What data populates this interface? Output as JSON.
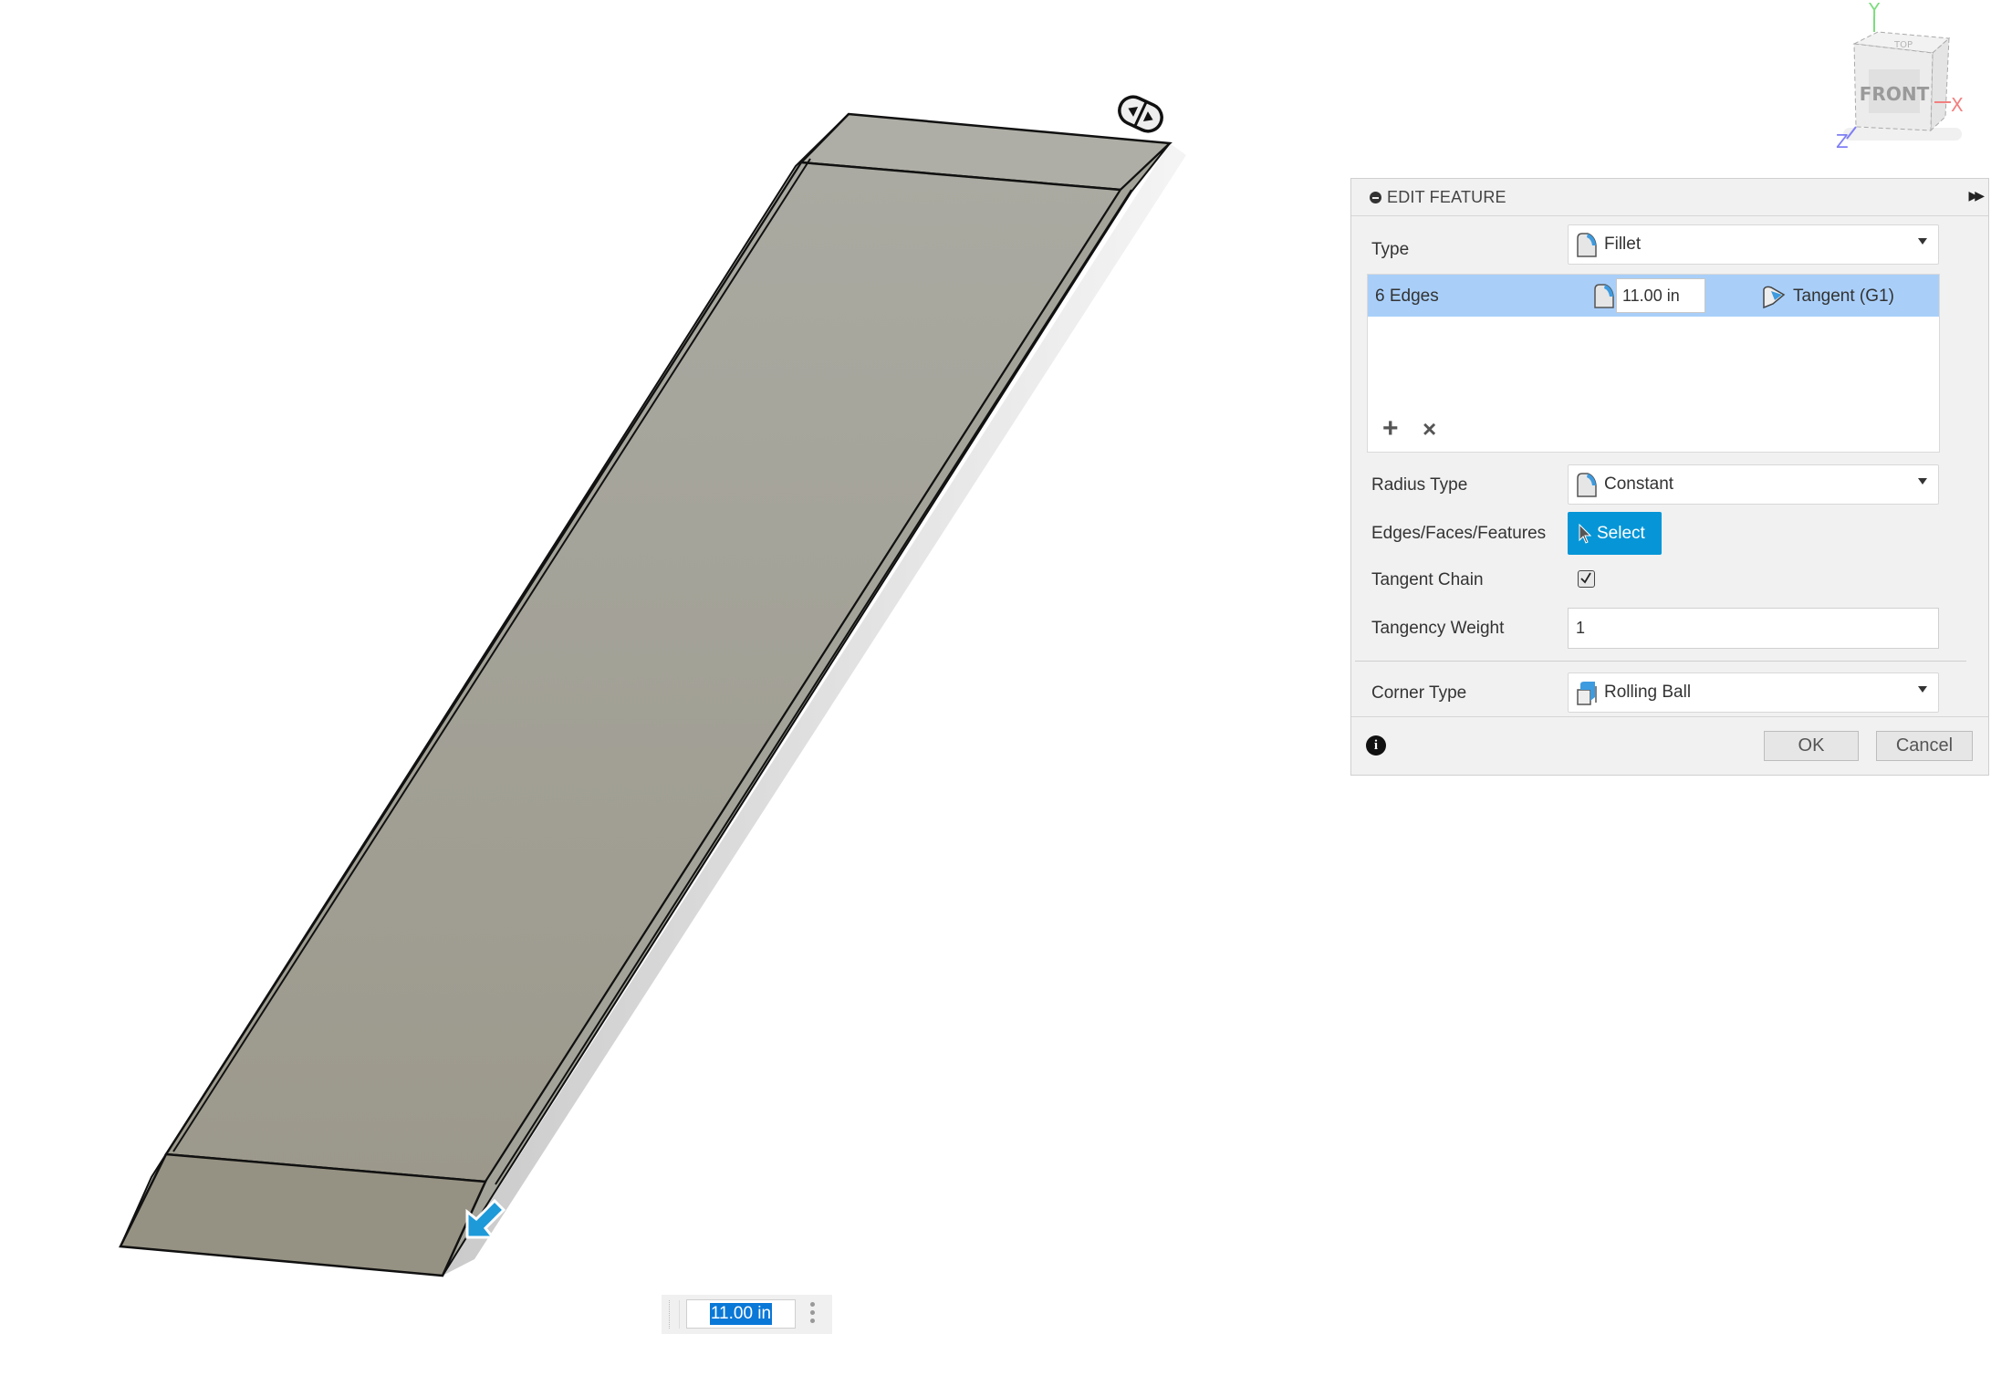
{
  "viewcube": {
    "face_label": "FRONT",
    "top_label": "TOP",
    "axis_x": "X",
    "axis_y": "Y",
    "axis_z": "Z",
    "axis_colors": {
      "x": "#f28080",
      "y": "#7ddc7d",
      "z": "#7f7ff5"
    }
  },
  "panel": {
    "title": "EDIT FEATURE",
    "type_label": "Type",
    "type_value": "Fillet",
    "edge_selection": {
      "count_label": "6 Edges",
      "radius": "11.00 in",
      "continuity": "Tangent (G1)"
    },
    "add_symbol": "+",
    "remove_symbol": "×",
    "radius_type_label": "Radius Type",
    "radius_type_value": "Constant",
    "edges_label": "Edges/Faces/Features",
    "select_label": "Select",
    "tangent_chain_label": "Tangent Chain",
    "tangent_chain_checked": true,
    "tangency_weight_label": "Tangency Weight",
    "tangency_weight_value": "1",
    "corner_type_label": "Corner Type",
    "corner_type_value": "Rolling Ball",
    "ok_label": "OK",
    "cancel_label": "Cancel",
    "info_symbol": "i"
  },
  "dimension_input": {
    "value": "11.00 in"
  },
  "colors": {
    "accent": "#0696d7",
    "selection_row": "#a9cff9",
    "body_face": "#a4a499",
    "body_end_face": "#969283",
    "manipulator_arrow": "#1e9ad9"
  }
}
